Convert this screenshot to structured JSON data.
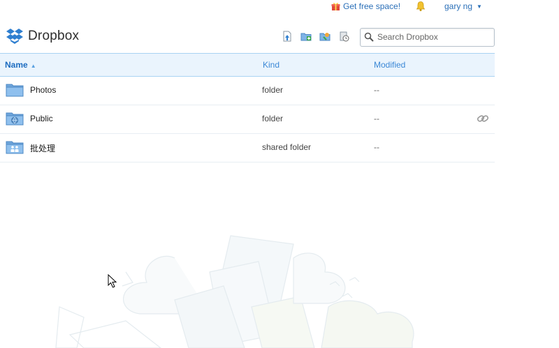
{
  "top": {
    "free_space_label": "Get free space!",
    "username": "gary ng"
  },
  "header": {
    "brand": "Dropbox"
  },
  "toolbar": {
    "icons": [
      "upload-icon",
      "new-folder-icon",
      "shared-folder-icon",
      "deleted-files-icon"
    ]
  },
  "search": {
    "placeholder": "Search Dropbox",
    "value": ""
  },
  "table": {
    "columns": {
      "name": "Name",
      "kind": "Kind",
      "modified": "Modified"
    },
    "rows": [
      {
        "name": "Photos",
        "kind": "folder",
        "modified": "--"
      },
      {
        "name": "Public",
        "kind": "folder",
        "modified": "--"
      },
      {
        "name": "批处理",
        "kind": "shared folder",
        "modified": "--"
      }
    ]
  },
  "colors": {
    "accent": "#2a6fb8",
    "header_bg": "#eaf4fd",
    "header_border": "#a9d3f3",
    "folder": "#7fb3e6"
  }
}
